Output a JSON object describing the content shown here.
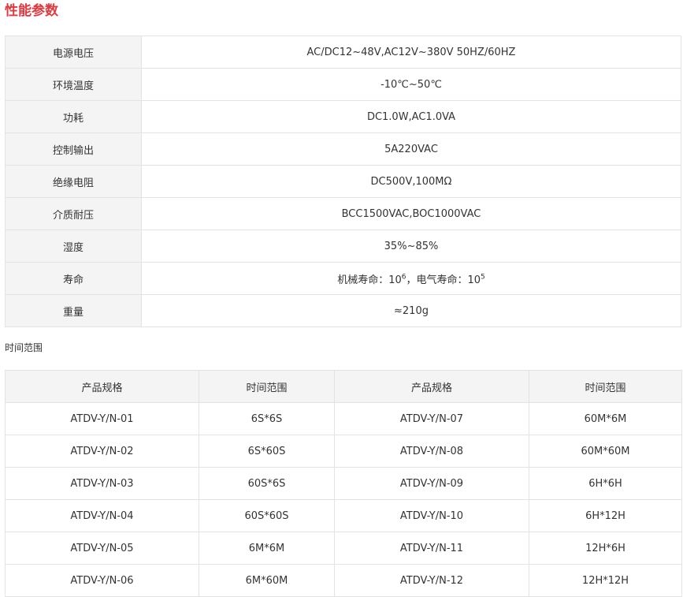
{
  "title": "性能参数",
  "specs": [
    {
      "label": "电源电压",
      "value": "AC/DC12~48V,AC12V~380V 50HZ/60HZ"
    },
    {
      "label": "环境温度",
      "value": "-10℃~50℃"
    },
    {
      "label": "功耗",
      "value": "DC1.0W,AC1.0VA"
    },
    {
      "label": "控制输出",
      "value": "5A220VAC"
    },
    {
      "label": "绝缘电阻",
      "value": "DC500V,100MΩ"
    },
    {
      "label": "介质耐压",
      "value": "BCC1500VAC,BOC1000VAC"
    },
    {
      "label": "湿度",
      "value": "35%~85%"
    },
    {
      "label": "寿命",
      "mech_prefix": "机械寿命：10",
      "mech_exp": "6",
      "elec_prefix": "，电气寿命：10",
      "elec_exp": "5"
    },
    {
      "label": "重量",
      "value": "≈210g"
    }
  ],
  "time_range_title": "时间范围",
  "time_table": {
    "headers": [
      "产品规格",
      "时间范围",
      "产品规格",
      "时间范围"
    ],
    "rows": [
      [
        "ATDV-Y/N-01",
        "6S*6S",
        "ATDV-Y/N-07",
        "60M*6M"
      ],
      [
        "ATDV-Y/N-02",
        "6S*60S",
        "ATDV-Y/N-08",
        "60M*60M"
      ],
      [
        "ATDV-Y/N-03",
        "60S*6S",
        "ATDV-Y/N-09",
        "6H*6H"
      ],
      [
        "ATDV-Y/N-04",
        "60S*60S",
        "ATDV-Y/N-10",
        "6H*12H"
      ],
      [
        "ATDV-Y/N-05",
        "6M*6M",
        "ATDV-Y/N-11",
        "12H*6H"
      ],
      [
        "ATDV-Y/N-06",
        "6M*60M",
        "ATDV-Y/N-12",
        "12H*12H"
      ]
    ]
  }
}
